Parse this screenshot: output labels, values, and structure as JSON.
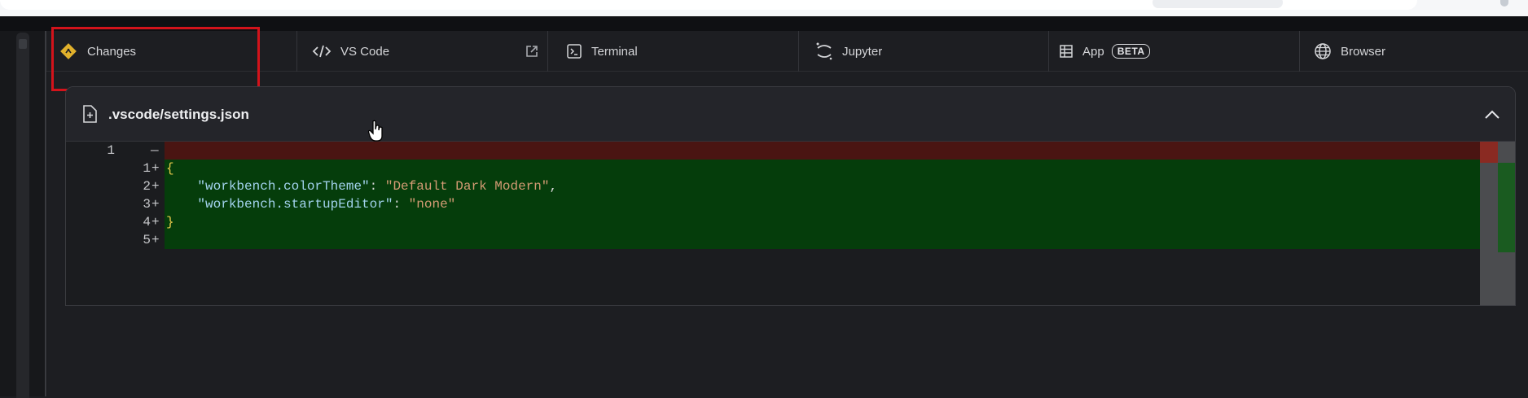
{
  "tabs": [
    {
      "id": "changes",
      "label": "Changes",
      "icon": "git-diamond-icon"
    },
    {
      "id": "vscode",
      "label": "VS Code",
      "icon": "code-brackets-icon",
      "extra_icon": "external-link-icon"
    },
    {
      "id": "terminal",
      "label": "Terminal",
      "icon": "terminal-icon"
    },
    {
      "id": "jupyter",
      "label": "Jupyter",
      "icon": "jupyter-icon"
    },
    {
      "id": "app",
      "label": "App",
      "icon": "grid-list-icon",
      "badge": "BETA"
    },
    {
      "id": "browser",
      "label": "Browser",
      "icon": "globe-icon"
    }
  ],
  "diff": {
    "file_name": ".vscode/settings.json",
    "file_icon": "file-plus-icon",
    "collapse_icon": "chevron-up-icon",
    "lines": [
      {
        "type": "del",
        "old_num": "1",
        "new_num": "",
        "marker": "—",
        "segments": []
      },
      {
        "type": "add",
        "old_num": "",
        "new_num": "1",
        "marker": "+",
        "segments": [
          {
            "cls": "tok-brace",
            "text": "{"
          }
        ]
      },
      {
        "type": "add",
        "old_num": "",
        "new_num": "2",
        "marker": "+",
        "segments": [
          {
            "cls": "tok-punc",
            "text": "    "
          },
          {
            "cls": "tok-key",
            "text": "\"workbench.colorTheme\""
          },
          {
            "cls": "tok-punc",
            "text": ": "
          },
          {
            "cls": "tok-str",
            "text": "\"Default Dark Modern\""
          },
          {
            "cls": "tok-punc",
            "text": ","
          }
        ]
      },
      {
        "type": "add",
        "old_num": "",
        "new_num": "3",
        "marker": "+",
        "segments": [
          {
            "cls": "tok-punc",
            "text": "    "
          },
          {
            "cls": "tok-key",
            "text": "\"workbench.startupEditor\""
          },
          {
            "cls": "tok-punc",
            "text": ": "
          },
          {
            "cls": "tok-str",
            "text": "\"none\""
          }
        ]
      },
      {
        "type": "add",
        "old_num": "",
        "new_num": "4",
        "marker": "+",
        "segments": [
          {
            "cls": "tok-brace",
            "text": "}"
          }
        ]
      },
      {
        "type": "add",
        "old_num": "",
        "new_num": "5",
        "marker": "+",
        "segments": []
      }
    ]
  },
  "colors": {
    "highlight_box": "#d3131b",
    "deleted_line": "#4a1512",
    "added_line": "#053d0b",
    "changes_icon": "#e1b12c"
  }
}
